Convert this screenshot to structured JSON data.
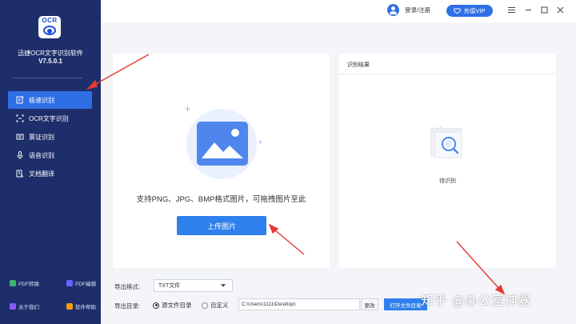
{
  "app": {
    "logo_text": "OCR",
    "name": "迅捷OCR文字识别软件",
    "version": "V7.5.0.1"
  },
  "sidebar": {
    "items": [
      {
        "label": "极速识别",
        "icon": "fast-recognize-icon",
        "active": true
      },
      {
        "label": "OCR文字识别",
        "icon": "ocr-scan-icon",
        "active": false
      },
      {
        "label": "票证识别",
        "icon": "ticket-icon",
        "active": false
      },
      {
        "label": "语音识别",
        "icon": "microphone-icon",
        "active": false
      },
      {
        "label": "文档翻译",
        "icon": "translate-doc-icon",
        "active": false
      }
    ],
    "footer": [
      {
        "label": "PDF转换",
        "color": "#3cb371"
      },
      {
        "label": "PDF编辑",
        "color": "#6c63ff"
      },
      {
        "label": "关于我们",
        "color": "#8a5cf6"
      },
      {
        "label": "软件帮助",
        "color": "#f59e0b"
      }
    ]
  },
  "topbar": {
    "login": "登录/注册",
    "vip": "充值VIP"
  },
  "upload": {
    "hint": "支持PNG、JPG、BMP格式图片，可拖拽图片至此",
    "button": "上传图片"
  },
  "result": {
    "title": "识别结果",
    "status": "待识别"
  },
  "export": {
    "format_label": "导出格式:",
    "format_value": "TXT文件",
    "dir_label": "导出目录:",
    "radio_source": "源文件目录",
    "radio_custom": "自定义",
    "source_selected": true,
    "path": "C:\\Users\\1111\\Desktop\\",
    "change_btn": "更改",
    "open_btn": "打开文件目录"
  },
  "watermark": "知乎 @办公室神器",
  "colors": {
    "sidebar": "#1d2e6b",
    "accent": "#2f80ed",
    "active": "#2f6fe6",
    "arrow": "#e53935"
  }
}
